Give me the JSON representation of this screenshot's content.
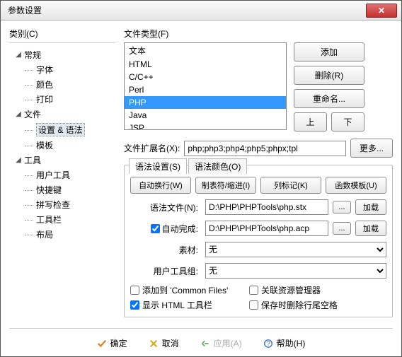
{
  "window": {
    "title": "参数设置"
  },
  "categories": {
    "label": "类别(C)",
    "groups": [
      {
        "name": "常规",
        "children": [
          "字体",
          "颜色",
          "打印"
        ]
      },
      {
        "name": "文件",
        "children": [
          "设置 & 语法",
          "模板"
        ],
        "selectedChild": 0
      },
      {
        "name": "工具",
        "children": [
          "用户工具",
          "快捷键",
          "拼写检查",
          "工具栏",
          "布局"
        ]
      }
    ]
  },
  "filetypes": {
    "label": "文件类型(F)",
    "items": [
      "文本",
      "HTML",
      "C/C++",
      "Perl",
      "PHP",
      "Java",
      "JSP"
    ],
    "selected": 4
  },
  "buttons": {
    "add": "添加",
    "delete": "删除(R)",
    "rename": "重命名...",
    "up": "上",
    "down": "下",
    "more": "更多...",
    "browse": "...",
    "load": "加载"
  },
  "ext": {
    "label": "文件扩展名(X):",
    "value": "php;php3;php4;php5;phpx;tpl"
  },
  "tabs": {
    "syntax": "语法设置(S)",
    "color": "语法颜色(O)"
  },
  "toolbar": {
    "wrap": "自动换行(W)",
    "tab": "制表符/缩进(I)",
    "col": "列标记(K)",
    "func": "函数模板(U)"
  },
  "form": {
    "syntaxFile": {
      "label": "语法文件(N):",
      "value": "D:\\PHP\\PHPTools\\php.stx"
    },
    "autoComplete": {
      "label": "自动完成:",
      "value": "D:\\PHP\\PHPTools\\php.acp",
      "checked": true
    },
    "material": {
      "label": "素材:",
      "value": "无"
    },
    "toolGroup": {
      "label": "用户工具组:",
      "value": "无"
    }
  },
  "checks": {
    "addCommon": {
      "label": "添加到 'Common Files'",
      "checked": false
    },
    "assocExplorer": {
      "label": "关联资源管理器",
      "checked": false
    },
    "showHtmlBar": {
      "label": "显示 HTML 工具栏",
      "checked": true
    },
    "trimTrailing": {
      "label": "保存时删除行尾空格",
      "checked": false
    }
  },
  "footer": {
    "ok": "确定",
    "cancel": "取消",
    "apply": "应用(A)",
    "help": "帮助(H)"
  }
}
